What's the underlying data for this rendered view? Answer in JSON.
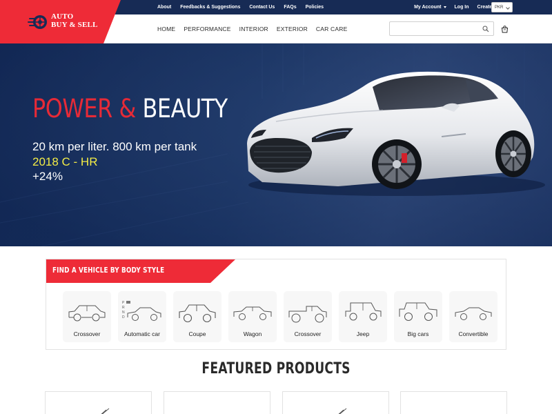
{
  "brand": {
    "line1": "AUTO",
    "line2": "BUY & SELL",
    "red": "#ee2b37",
    "navy": "#172b55"
  },
  "topbar": {
    "left_links": [
      "About",
      "Feedbacks & Suggestions",
      "Contact Us",
      "FAQs",
      "Policies"
    ],
    "my_account": "My Account",
    "login": "Log In",
    "create_account": "Create Account",
    "currency": "PKR"
  },
  "nav": {
    "items": [
      "HOME",
      "PERFORMANCE",
      "INTERIOR",
      "EXTERIOR",
      "CAR CARE"
    ],
    "search_placeholder": ""
  },
  "hero": {
    "title_red": "POWER &",
    "title_white": "BEAUTY",
    "line1": "20 km per liter. 800 km per tank",
    "line2": "2018 C - HR",
    "line3": "+24%"
  },
  "body_style": {
    "title": "FIND A VEHICLE BY BODY STYLE",
    "items": [
      {
        "label": "Crossover",
        "icon": "crossover-icon"
      },
      {
        "label": "Automatic car",
        "icon": "automatic-car-icon"
      },
      {
        "label": "Coupe",
        "icon": "coupe-icon"
      },
      {
        "label": "Wagon",
        "icon": "wagon-icon"
      },
      {
        "label": "Crossover",
        "icon": "pickup-icon"
      },
      {
        "label": "Jeep",
        "icon": "jeep-icon"
      },
      {
        "label": "Big cars",
        "icon": "big-car-icon"
      },
      {
        "label": "Convertible",
        "icon": "convertible-icon"
      }
    ]
  },
  "featured": {
    "title": "FEATURED PRODUCTS"
  }
}
